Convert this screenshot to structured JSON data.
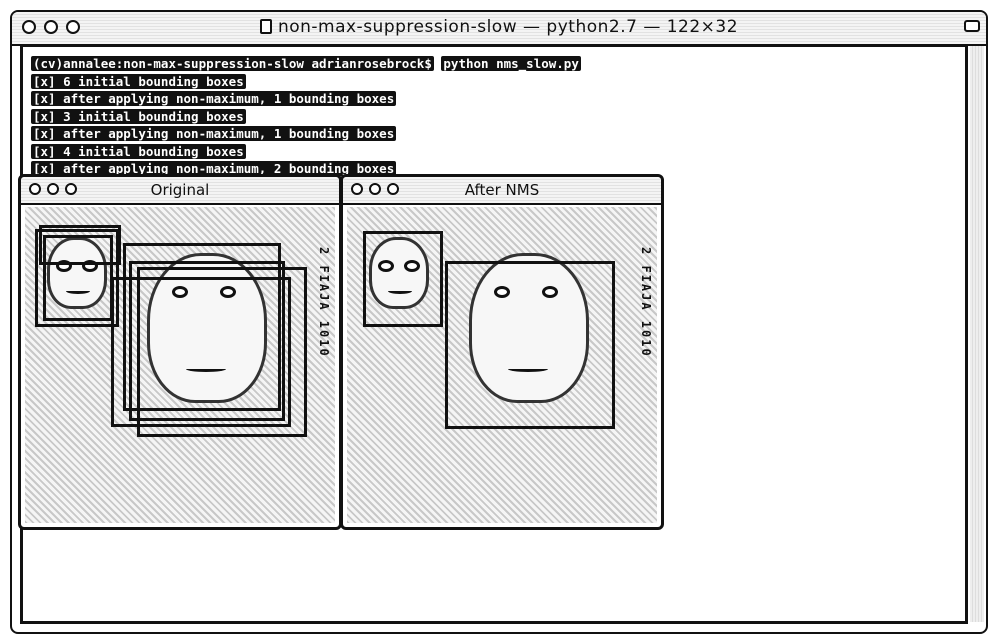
{
  "window": {
    "title": "non-max-suppression-slow — python2.7 — 122×32"
  },
  "terminal": {
    "prompt": "(cv)annalee:non-max-suppression-slow adrianrosebrock$",
    "command": "python nms_slow.py",
    "lines": [
      "[x] 6 initial bounding boxes",
      "[x] after applying non-maximum, 1 bounding boxes",
      "[x] 3 initial bounding boxes",
      "[x] after applying non-maximum, 1 bounding boxes",
      "[x] 4 initial bounding boxes",
      "[x] after applying non-maximum, 2 bounding boxes"
    ]
  },
  "image_windows": {
    "original": {
      "title": "Original"
    },
    "after_nms": {
      "title": "After NMS"
    }
  },
  "photo": {
    "side_text": "2 FIAJA 1010"
  }
}
